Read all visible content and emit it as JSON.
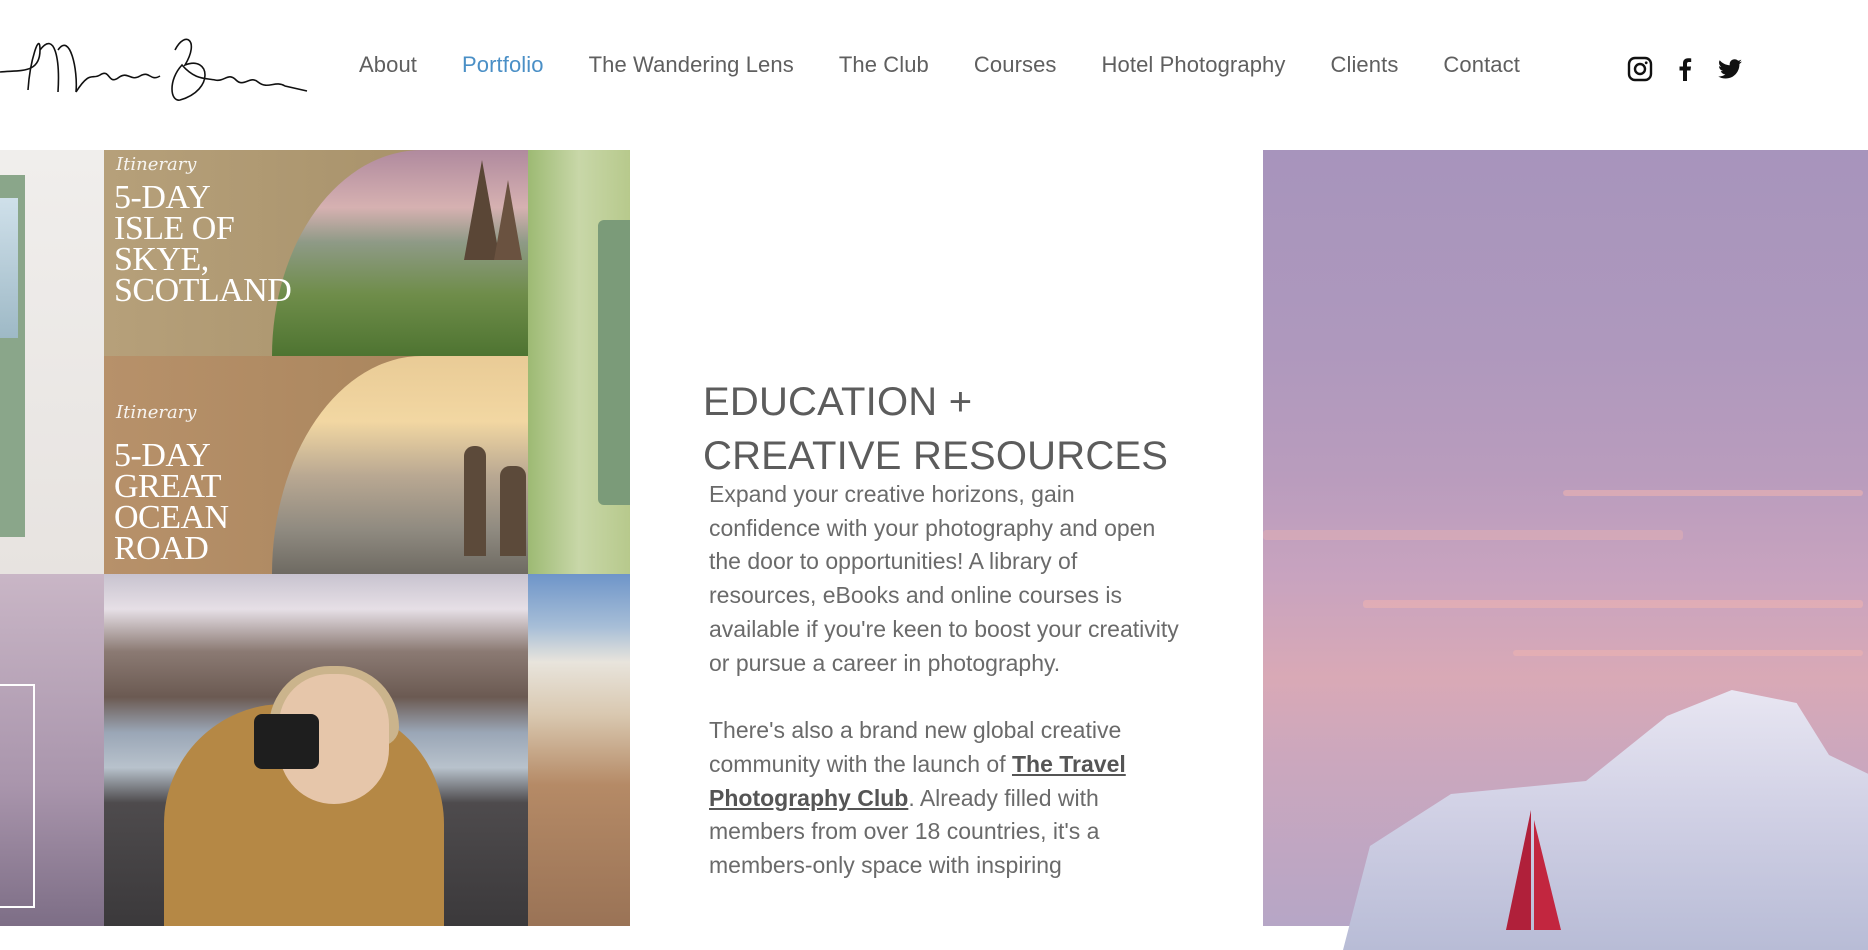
{
  "logo": {
    "text": "Michele Burns"
  },
  "nav": {
    "items": [
      {
        "label": "About"
      },
      {
        "label": "Portfolio",
        "active": true
      },
      {
        "label": "The Wandering Lens"
      },
      {
        "label": "The Club"
      },
      {
        "label": "Courses"
      },
      {
        "label": "Hotel Photography"
      },
      {
        "label": "Clients"
      },
      {
        "label": "Contact"
      }
    ],
    "active_color": "#4a8fc6"
  },
  "social": {
    "icons": [
      "instagram-icon",
      "facebook-icon",
      "twitter-icon"
    ]
  },
  "collage": {
    "skye": {
      "kicker": "Itinerary",
      "title_lines": [
        "5-DAY",
        "ISLE OF",
        "SKYE,",
        "SCOTLAND"
      ]
    },
    "ocean": {
      "kicker": "Itinerary",
      "title_lines": [
        "5-DAY",
        "GREAT",
        "OCEAN",
        "ROAD"
      ]
    }
  },
  "section": {
    "heading_line1": "EDUCATION +",
    "heading_line2": "CREATIVE RESOURCES",
    "para1": "Expand your creative horizons, gain confidence with your photography and open the door to opportunities! A library of resources, eBooks and online courses is available if you're keen to boost your creativity or pursue a career in photography.",
    "para2_before": "There's also a brand new global creative community with the launch of ",
    "para2_link": "The Travel Photography Club",
    "para2_after": ". Already filled with members from over 18 countries, it's a members-only space with inspiring"
  }
}
